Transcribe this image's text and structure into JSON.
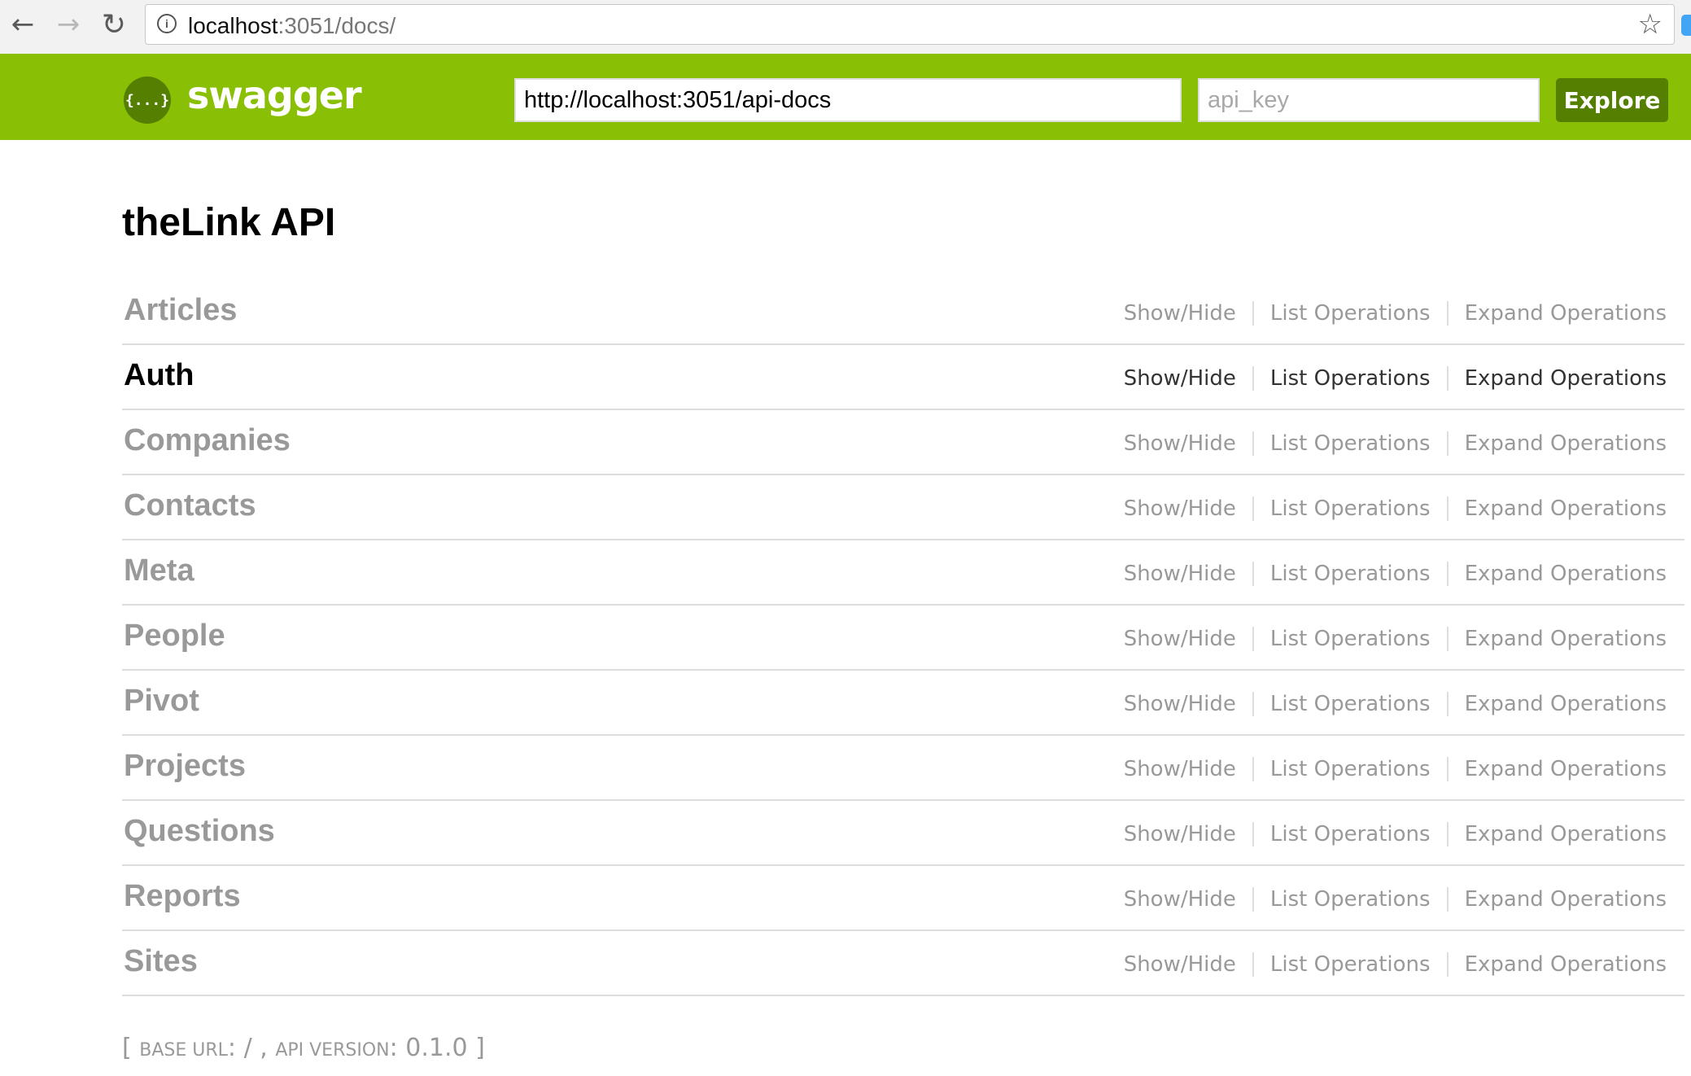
{
  "browser": {
    "url_host": "localhost",
    "url_rest": ":3051/docs/"
  },
  "header": {
    "logo_text": "swagger",
    "logo_glyph": "{...}",
    "url_input_value": "http://localhost:3051/api-docs",
    "api_key_placeholder": "api_key",
    "explore_label": "Explore",
    "brand_color": "#89bf04",
    "button_color": "#547f00"
  },
  "main": {
    "title": "theLink API",
    "op_labels": {
      "show_hide": "Show/Hide",
      "list": "List Operations",
      "expand": "Expand Operations"
    },
    "resources": [
      {
        "name": "Articles",
        "active": false
      },
      {
        "name": "Auth",
        "active": true
      },
      {
        "name": "Companies",
        "active": false
      },
      {
        "name": "Contacts",
        "active": false
      },
      {
        "name": "Meta",
        "active": false
      },
      {
        "name": "People",
        "active": false
      },
      {
        "name": "Pivot",
        "active": false
      },
      {
        "name": "Projects",
        "active": false
      },
      {
        "name": "Questions",
        "active": false
      },
      {
        "name": "Reports",
        "active": false
      },
      {
        "name": "Sites",
        "active": false
      }
    ]
  },
  "footer": {
    "open_bracket": "[",
    "base_url_label": "base url",
    "base_url_value": "/",
    "comma": ",",
    "api_version_label": "api version",
    "api_version_value": "0.1.0",
    "close_bracket": "]"
  }
}
